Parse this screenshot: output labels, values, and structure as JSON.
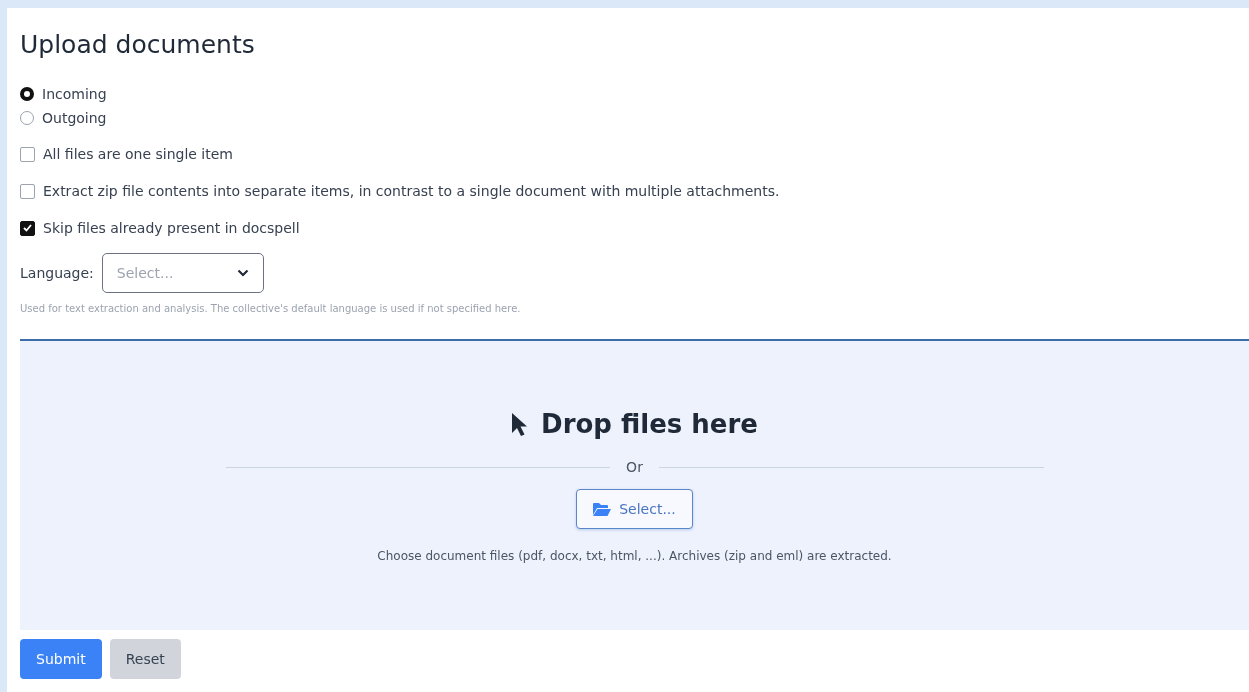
{
  "title": "Upload documents",
  "direction": [
    {
      "label": "Incoming",
      "selected": true
    },
    {
      "label": "Outgoing",
      "selected": false
    }
  ],
  "options": [
    {
      "label": "All files are one single item",
      "checked": false
    },
    {
      "label": "Extract zip file contents into separate items, in contrast to a single document with multiple attachments.",
      "checked": false
    },
    {
      "label": "Skip files already present in docspell",
      "checked": true
    }
  ],
  "language": {
    "label": "Language:",
    "placeholder": "Select...",
    "hint": "Used for text extraction and analysis. The collective's default language is used if not specified here."
  },
  "dropzone": {
    "heading": "Drop files here",
    "separator": "Or",
    "button": "Select...",
    "description": "Choose document files (pdf, docx, txt, html, ...). Archives (zip and eml) are extracted."
  },
  "buttons": [
    {
      "label": "Submit",
      "kind": "primary"
    },
    {
      "label": "Reset",
      "kind": "secondary"
    }
  ]
}
